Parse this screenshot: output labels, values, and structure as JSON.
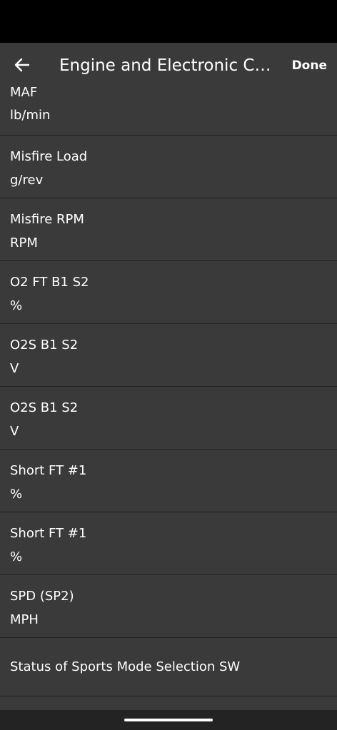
{
  "header": {
    "title": "Engine and Electronic Co...",
    "done_label": "Done"
  },
  "icons": {
    "back": "arrow-left-icon"
  },
  "colors": {
    "background": "#3a3a3a",
    "divider": "#232323",
    "status_bar": "#000000",
    "text": "#ffffff"
  },
  "items": [
    {
      "name": "MAF",
      "unit": "lb/min"
    },
    {
      "name": "Misfire Load",
      "unit": "g/rev"
    },
    {
      "name": "Misfire RPM",
      "unit": "RPM"
    },
    {
      "name": "O2 FT B1 S2",
      "unit": "%"
    },
    {
      "name": "O2S B1 S2",
      "unit": "V"
    },
    {
      "name": "O2S B1 S2",
      "unit": "V"
    },
    {
      "name": "Short FT #1",
      "unit": "%"
    },
    {
      "name": "Short FT #1",
      "unit": "%"
    },
    {
      "name": "SPD (SP2)",
      "unit": "MPH"
    },
    {
      "name": "Status of Sports Mode Selection SW"
    }
  ]
}
